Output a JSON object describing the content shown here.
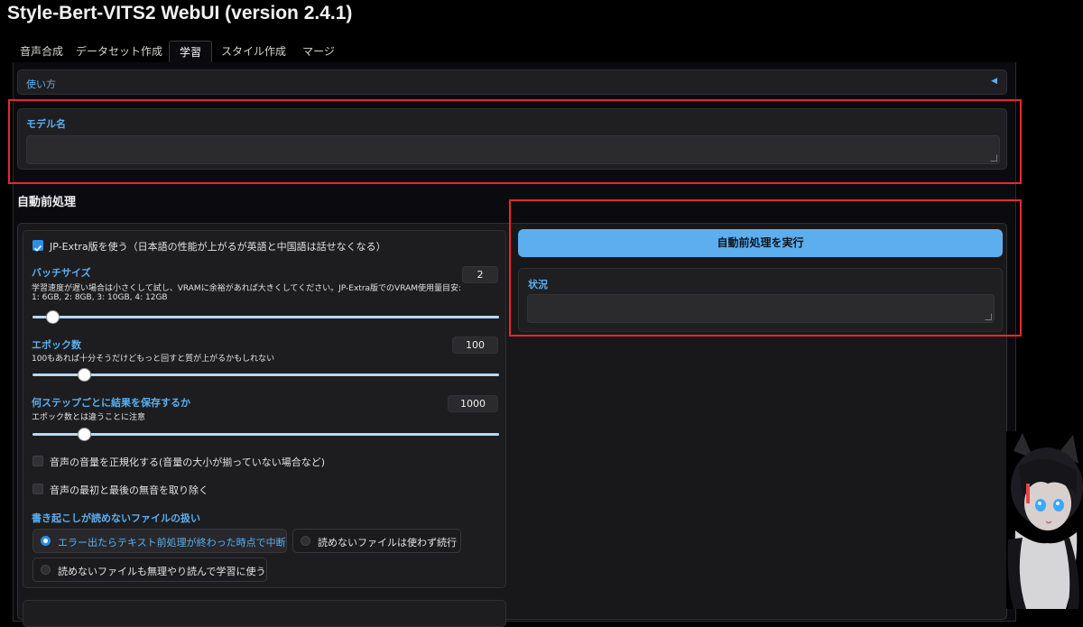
{
  "app": {
    "title": "Style-Bert-VITS2 WebUI (version 2.4.1)"
  },
  "tabs": [
    {
      "label": "音声合成"
    },
    {
      "label": "データセット作成"
    },
    {
      "label": "学習"
    },
    {
      "label": "スタイル作成"
    },
    {
      "label": "マージ"
    }
  ],
  "active_tab": "学習",
  "usage": {
    "label": "使い方",
    "toggle_icon": "triangle-left-icon"
  },
  "model_name": {
    "label": "モデル名",
    "value": ""
  },
  "auto_preprocess": {
    "heading": "自動前処理",
    "jp_extra": {
      "label": "JP-Extra版を使う（日本語の性能が上がるが英語と中国語は話せなくなる）",
      "checked": true
    },
    "batch_size": {
      "label": "バッチサイズ",
      "info_line1": "学習速度が遅い場合は小さくして試し、VRAMに余裕があれば大きくしてください。JP-Extra版でのVRAM使用量目安:",
      "info_line2": "1: 6GB, 2: 8GB, 3: 10GB, 4: 12GB",
      "value": "2",
      "slider_fraction": 0.03
    },
    "epochs": {
      "label": "エポック数",
      "info": "100もあれば十分そうだけどもっと回すと質が上がるかもしれない",
      "value": "100",
      "slider_fraction": 0.1
    },
    "save_every_steps": {
      "label": "何ステップごとに結果を保存するか",
      "info": "エポック数とは違うことに注意",
      "value": "1000",
      "slider_fraction": 0.1
    },
    "normalize": {
      "label": "音声の音量を正規化する(音量の大小が揃っていない場合など)",
      "checked": false
    },
    "trim": {
      "label": "音声の最初と最後の無音を取り除く",
      "checked": false
    },
    "unreadable_files": {
      "label": "書き起こしが読めないファイルの扱い",
      "options": [
        "エラー出たらテキスト前処理が終わった時点で中断",
        "読めないファイルは使わず続行",
        "読めないファイルも無理やり読んで学習に使う"
      ],
      "selected": "エラー出たらテキスト前処理が終わった時点で中断"
    },
    "run_button": {
      "label": "自動前処理を実行"
    },
    "status": {
      "label": "状況",
      "value": ""
    }
  },
  "colors": {
    "accent_blue": "#5daeee",
    "label_blue": "#5aaff0",
    "highlight_red": "#e8282d",
    "background": "#000000"
  }
}
